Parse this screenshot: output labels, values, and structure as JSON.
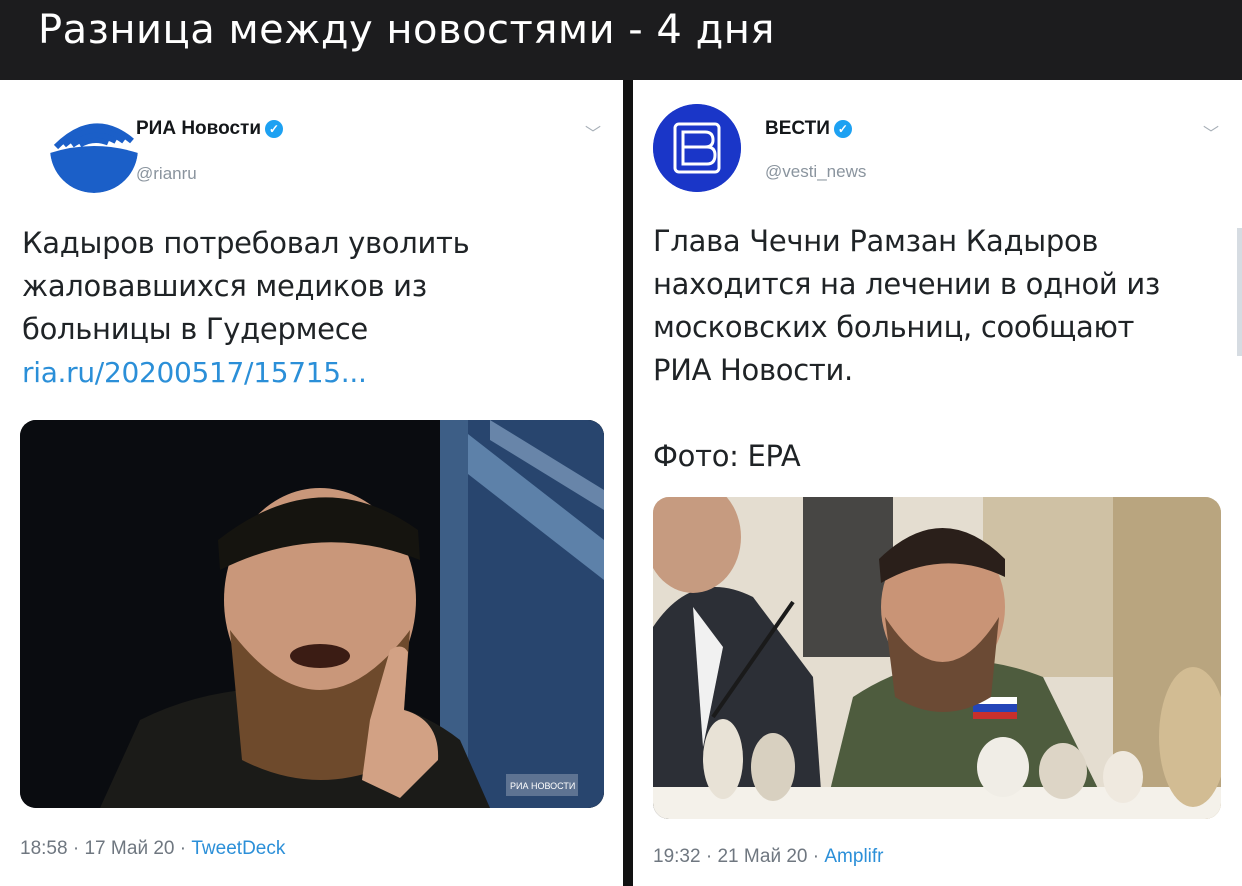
{
  "header": {
    "title": "Разница между новостями - 4 дня"
  },
  "tweets": [
    {
      "account_name": "РИА Новости",
      "handle": "@rianru",
      "text_lines": [
        "Кадыров потребовал уволить",
        "жаловавшихся медиков из",
        "больницы в Гудермесе"
      ],
      "link": "ria.ru/20200517/15715...",
      "time": "18:58",
      "date": "17 Май 20",
      "source": "TweetDeck",
      "watermark": "РИА НОВОСТИ"
    },
    {
      "account_name": "ВЕСТИ",
      "handle": "@vesti_news",
      "text_lines": [
        "Глава Чечни Рамзан Кадыров",
        "находится на лечении в одной из",
        "московских больниц, сообщают",
        "РИА Новости."
      ],
      "photo_credit": "Фото: EPA",
      "time": "19:32",
      "date": "21 Май 20",
      "source": "Amplifr"
    }
  ],
  "ui": {
    "separator": "·",
    "verified_mark": "✓",
    "chevron": "﹀"
  },
  "colors": {
    "link": "#2b8fd8",
    "verified": "#1da1f2",
    "ria_blue": "#1b5fc8",
    "vesti_blue": "#1a36c8"
  }
}
